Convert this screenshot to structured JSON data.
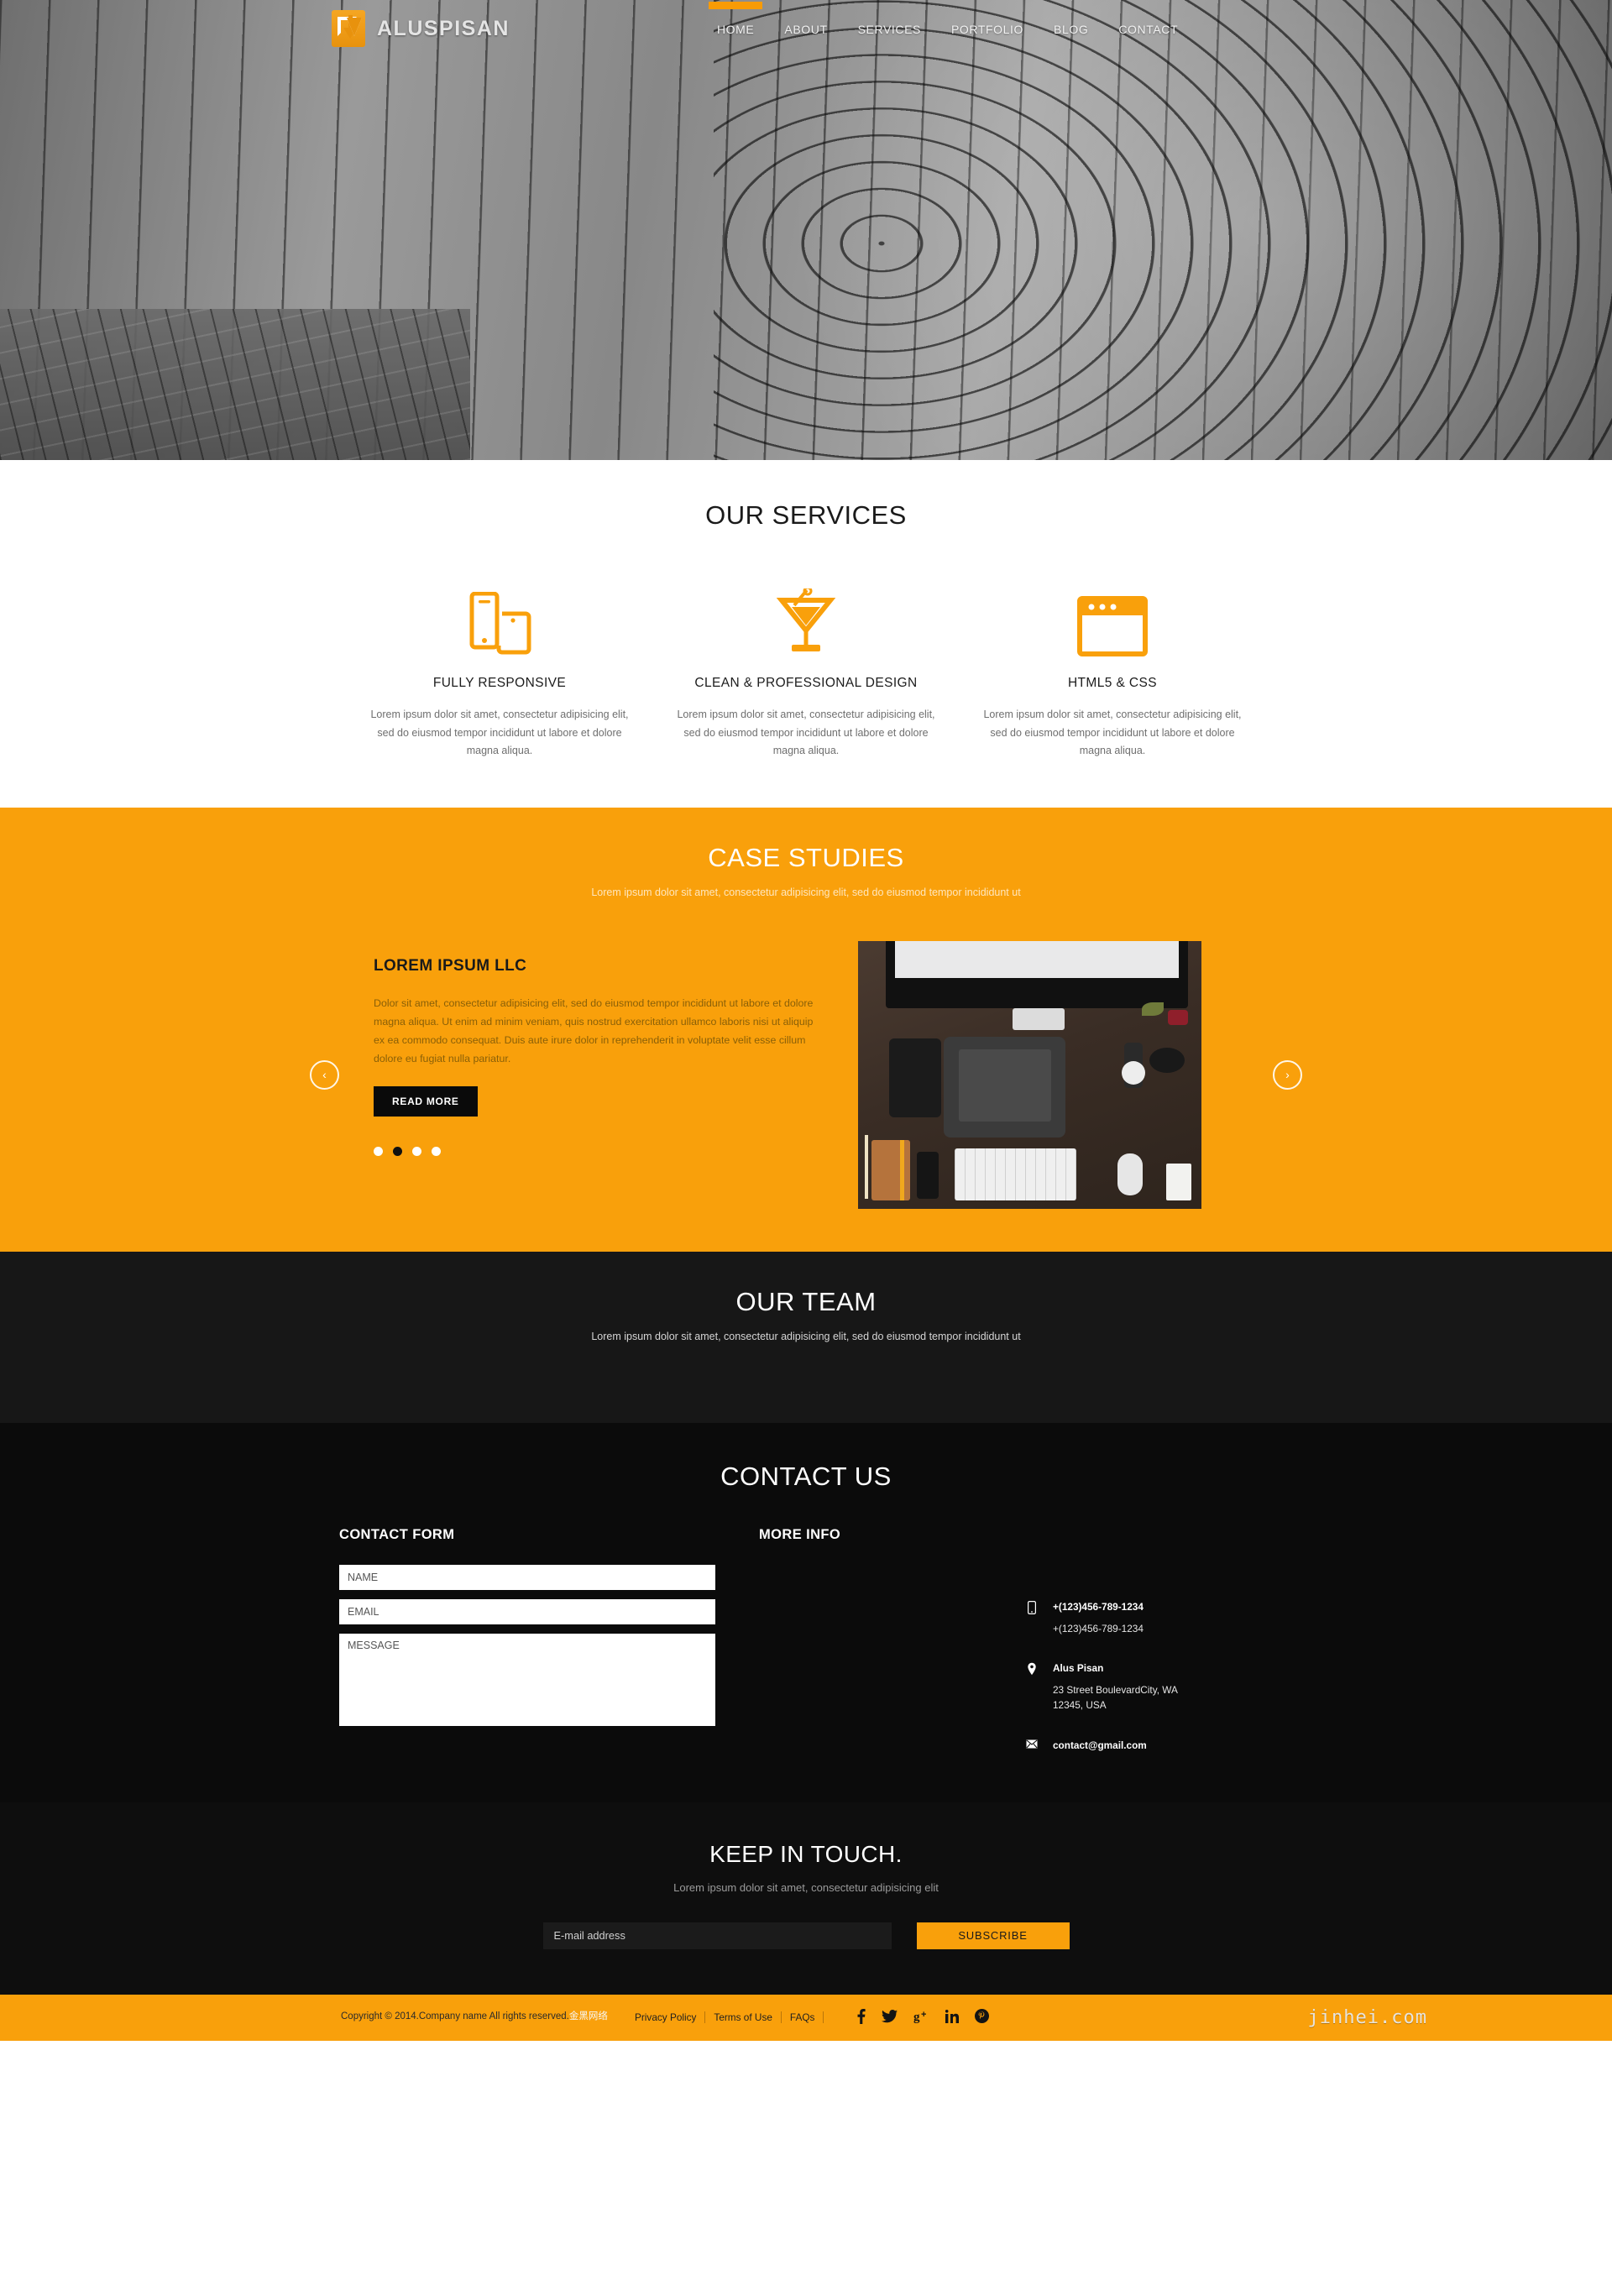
{
  "header": {
    "brand": "ALUSPISAN",
    "logo_color": "#f5a623",
    "nav": [
      {
        "label": "HOME",
        "active": true
      },
      {
        "label": "ABOUT",
        "active": false
      },
      {
        "label": "SERVICES",
        "active": false
      },
      {
        "label": "PORTFOLIO",
        "active": false
      },
      {
        "label": "BLOG",
        "active": false
      },
      {
        "label": "CONTACT",
        "active": false
      }
    ]
  },
  "services": {
    "title": "OUR SERVICES",
    "items": [
      {
        "icon": "devices-responsive-icon",
        "name": "FULLY RESPONSIVE",
        "copy": "Lorem ipsum dolor sit amet, consectetur adipisicing elit, sed do eiusmod tempor incididunt ut labore et dolore magna aliqua."
      },
      {
        "icon": "cocktail-glass-icon",
        "name": "CLEAN & PROFESSIONAL DESIGN",
        "copy": "Lorem ipsum dolor sit amet, consectetur adipisicing elit, sed do eiusmod tempor incididunt ut labore et dolore magna aliqua."
      },
      {
        "icon": "browser-window-icon",
        "name": "HTML5 & CSS",
        "copy": "Lorem ipsum dolor sit amet, consectetur adipisicing elit, sed do eiusmod tempor incididunt ut labore et dolore magna aliqua."
      }
    ]
  },
  "cases": {
    "title": "CASE STUDIES",
    "subtitle": "Lorem ipsum dolor sit amet, consectetur adipisicing elit, sed do eiusmod tempor incididunt ut",
    "accent": "#f9a00b",
    "slide": {
      "heading": "LOREM IPSUM LLC",
      "body": "Dolor sit amet, consectetur adipisicing elit, sed do eiusmod tempor incididunt ut labore et dolore magna aliqua. Ut enim ad minim veniam, quis nostrud exercitation ullamco laboris nisi ut aliquip ex ea commodo consequat. Duis aute irure dolor in reprehenderit in voluptate velit esse cillum dolore eu fugiat nulla pariatur.",
      "button": "READ MORE",
      "image_alt": "desk-flatlay-photo"
    },
    "dots_total": 4,
    "dot_active_index": 1,
    "prev_label": "‹",
    "next_label": "›"
  },
  "team": {
    "title": "OUR TEAM",
    "subtitle": "Lorem ipsum dolor sit amet, consectetur adipisicing elit, sed do eiusmod tempor incididunt ut"
  },
  "contact": {
    "title": "CONTACT US",
    "form_heading": "CONTACT FORM",
    "info_heading": "MORE INFO",
    "fields": {
      "name_placeholder": "NAME",
      "email_placeholder": "EMAIL",
      "message_placeholder": "MESSAGE"
    },
    "info": {
      "phone_primary": "+(123)456-789-1234",
      "phone_secondary": "+(123)456-789-1234",
      "location_name": "Alus Pisan",
      "address_line1": "23 Street BoulevardCity, WA",
      "address_line2": "12345, USA",
      "email": "contact@gmail.com"
    }
  },
  "keep": {
    "title": "KEEP IN TOUCH.",
    "subtitle": "Lorem ipsum dolor sit amet, consectetur adipisicing elit",
    "email_placeholder": "E-mail address",
    "subscribe_label": "SUBSCRIBE"
  },
  "footer": {
    "copyright": "Copyright © 2014.Company name All rights reserved.",
    "copyright_suffix": "金黑网络",
    "links": [
      "Privacy Policy",
      "Terms of Use",
      "FAQs"
    ],
    "socials": [
      {
        "name": "facebook-icon",
        "glyph": "f"
      },
      {
        "name": "twitter-icon",
        "glyph": "ᵗ"
      },
      {
        "name": "googleplus-icon",
        "glyph": "g+"
      },
      {
        "name": "linkedin-icon",
        "glyph": "in"
      },
      {
        "name": "pinterest-icon",
        "glyph": "Ⓟ"
      }
    ],
    "watermark": "jinhei.com"
  }
}
